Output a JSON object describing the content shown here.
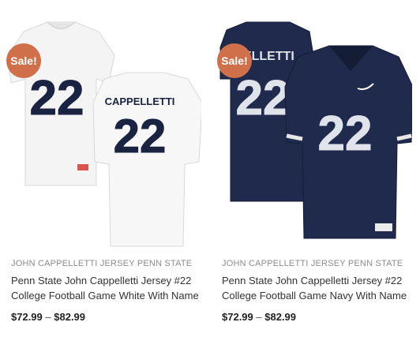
{
  "products": [
    {
      "badge": "Sale!",
      "category": "JOHN CAPPELLETTI JERSEY PENN STATE",
      "title": "Penn State John Cappelletti Jersey #22 College Football Game White With Name",
      "price_min": "$72.99",
      "price_sep": "–",
      "price_max": "$82.99",
      "jersey": {
        "color": "#f2f2f2",
        "number_color": "#1b2343",
        "number": "22",
        "name": "CAPPELLETTI"
      }
    },
    {
      "badge": "Sale!",
      "category": "JOHN CAPPELLETTI JERSEY PENN STATE",
      "title": "Penn State John Cappelletti Jersey #22 College Football Game Navy With Name",
      "price_min": "$72.99",
      "price_sep": "–",
      "price_max": "$82.99",
      "jersey": {
        "color": "#1f2a4c",
        "number_color": "#dfe3ea",
        "number": "22",
        "name": "PELLETTI"
      }
    }
  ],
  "colors": {
    "sale_badge": "#d0704a",
    "category_text": "#8c8c8c"
  }
}
